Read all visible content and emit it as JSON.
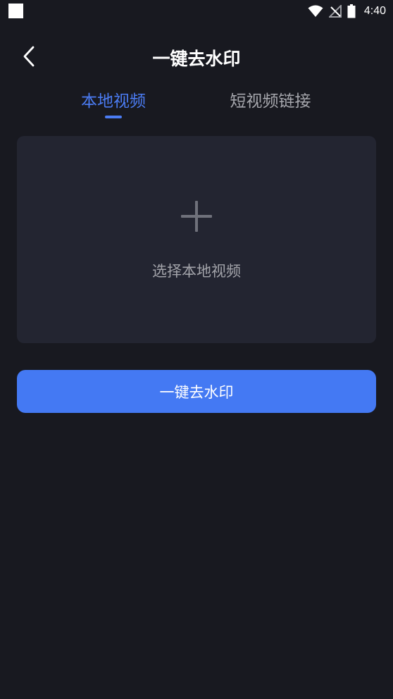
{
  "status_bar": {
    "time": "4:40",
    "icons": [
      "notification-square-icon",
      "wifi-icon",
      "no-signal-icon",
      "battery-icon"
    ]
  },
  "header": {
    "title": "一键去水印",
    "back_icon": "chevron-left-icon"
  },
  "tabs": [
    {
      "label": "本地视频",
      "active": true
    },
    {
      "label": "短视频链接",
      "active": false
    }
  ],
  "upload": {
    "icon": "plus-icon",
    "label": "选择本地视频"
  },
  "primary_button": {
    "label": "一键去水印"
  },
  "colors": {
    "background": "#181920",
    "card": "#232531",
    "accent": "#4479f3",
    "tab_inactive": "#a6a7ad"
  }
}
